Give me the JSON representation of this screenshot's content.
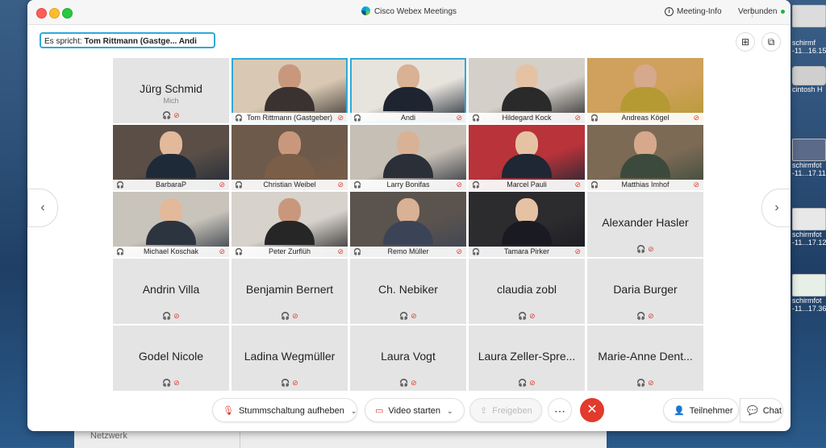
{
  "window": {
    "title": "Cisco Webex Meetings",
    "meeting_info": "Meeting-Info",
    "status": "Verbunden"
  },
  "speaker": {
    "prefix": "Es spricht:",
    "names": "Tom Rittmann (Gastge...   Andi"
  },
  "tiles": [
    {
      "name": "Jürg Schmid",
      "sub": "Mich",
      "video": false
    },
    {
      "name": "Tom Rittmann  (Gastgeber)",
      "video": true,
      "active": true
    },
    {
      "name": "Andi",
      "video": true,
      "active": true
    },
    {
      "name": "Hildegard Kock",
      "video": true
    },
    {
      "name": "Andreas Kögel",
      "video": true
    },
    {
      "name": "BarbaraP",
      "video": true
    },
    {
      "name": "Christian Weibel",
      "video": true
    },
    {
      "name": "Larry Bonifas",
      "video": true
    },
    {
      "name": "Marcel Pauli",
      "video": true
    },
    {
      "name": "Matthias Imhof",
      "video": true
    },
    {
      "name": "Michael Koschak",
      "video": true
    },
    {
      "name": "Peter Zurflüh",
      "video": true
    },
    {
      "name": "Remo Müller",
      "video": true
    },
    {
      "name": "Tamara Pirker",
      "video": true
    },
    {
      "name": "Alexander Hasler",
      "video": false
    },
    {
      "name": "Andrin Villa",
      "video": false
    },
    {
      "name": "Benjamin Bernert",
      "video": false
    },
    {
      "name": "Ch. Nebiker",
      "video": false
    },
    {
      "name": "claudia zobl",
      "video": false
    },
    {
      "name": "Daria Burger",
      "video": false
    },
    {
      "name": "Godel Nicole",
      "video": false
    },
    {
      "name": "Ladina Wegmüller",
      "video": false
    },
    {
      "name": "Laura Vogt",
      "video": false
    },
    {
      "name": "Laura Zeller-Spre...",
      "video": false
    },
    {
      "name": "Marie-Anne Dent...",
      "video": false
    }
  ],
  "controls": {
    "unmute": "Stummschaltung aufheben",
    "video": "Video starten",
    "share": "Freigeben",
    "participants": "Teilnehmer",
    "chat": "Chat"
  },
  "desktop": {
    "items": [
      "schirmf",
      "-11...16.15",
      "cintosh H",
      "schirmfot",
      "-11...17.11",
      "schirmfot",
      "-11...17.12",
      "schirmfot",
      "-11...17.36"
    ],
    "behind_label": "Netzwerk"
  },
  "colors": {
    "accent": "#2fa9d8",
    "end_call": "#e23a2c",
    "tile_bg": "#e4e4e4"
  }
}
